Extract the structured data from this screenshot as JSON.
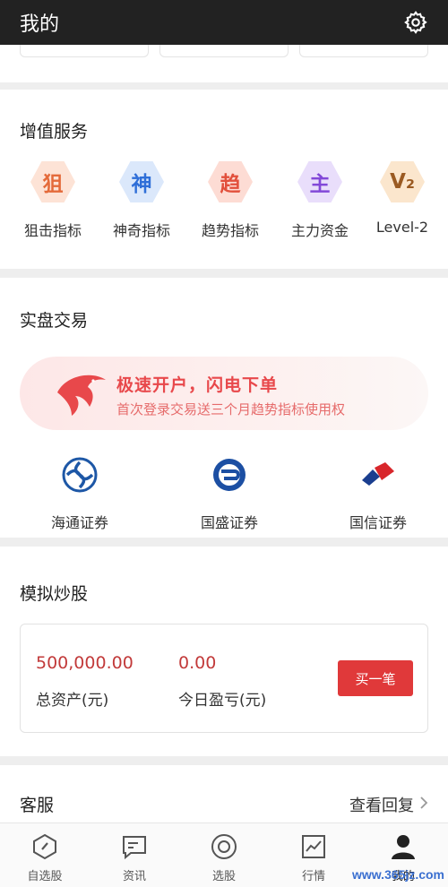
{
  "header": {
    "title": "我的"
  },
  "value_added": {
    "title": "增值服务",
    "items": [
      {
        "glyph": "狙",
        "label": "狙击指标",
        "color": "#e46a3a",
        "bg": "#fde3d6"
      },
      {
        "glyph": "神",
        "label": "神奇指标",
        "color": "#2f6fd8",
        "bg": "#dbe8fb"
      },
      {
        "glyph": "趋",
        "label": "趋势指标",
        "color": "#e2503c",
        "bg": "#fddcd4"
      },
      {
        "glyph": "主",
        "label": "主力资金",
        "color": "#8248d8",
        "bg": "#e9defb"
      },
      {
        "glyph": "V₂",
        "label": "Level-2",
        "color": "#9a5a22",
        "bg": "#fbe6cd"
      }
    ]
  },
  "trading": {
    "title": "实盘交易",
    "banner_title": "极速开户，闪电下单",
    "banner_subtitle": "首次登录交易送三个月趋势指标使用权",
    "brokers": [
      {
        "label": "海通证券"
      },
      {
        "label": "国盛证券"
      },
      {
        "label": "国信证券"
      }
    ]
  },
  "simulated": {
    "title": "模拟炒股",
    "total_assets_value": "500,000.00",
    "total_assets_label": "总资产(元)",
    "today_pnl_value": "0.00",
    "today_pnl_label": "今日盈亏(元)",
    "buy_label": "买一笔"
  },
  "service": {
    "title": "客服",
    "view_reply": "查看回复"
  },
  "bottom_nav": [
    {
      "label": "自选股",
      "icon": "watchlist-icon"
    },
    {
      "label": "资讯",
      "icon": "news-icon"
    },
    {
      "label": "选股",
      "icon": "stock-picker-icon"
    },
    {
      "label": "行情",
      "icon": "market-icon"
    },
    {
      "label": "我的",
      "icon": "profile-icon"
    }
  ],
  "watermark": "www.365jz.com"
}
